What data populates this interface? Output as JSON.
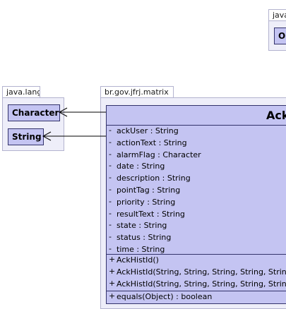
{
  "packages": {
    "java_lang": {
      "name": "java.lang",
      "classes": [
        "Character",
        "String"
      ]
    },
    "java_top": {
      "name": "java.",
      "class_partial": "Ob"
    },
    "matrix": {
      "name": "br.gov.jfrj.matrix"
    }
  },
  "main_class": {
    "name": "Ack",
    "attributes": [
      {
        "vis": "-",
        "text": "ackUser : String"
      },
      {
        "vis": "-",
        "text": "actionText : String"
      },
      {
        "vis": "-",
        "text": "alarmFlag : Character"
      },
      {
        "vis": "-",
        "text": "date : String"
      },
      {
        "vis": "-",
        "text": "description : String"
      },
      {
        "vis": "-",
        "text": "pointTag : String"
      },
      {
        "vis": "-",
        "text": "priority : String"
      },
      {
        "vis": "-",
        "text": "resultText : String"
      },
      {
        "vis": "-",
        "text": "state : String"
      },
      {
        "vis": "-",
        "text": "status : String"
      },
      {
        "vis": "-",
        "text": "time : String"
      }
    ],
    "constructors": [
      {
        "vis": "+",
        "text": "AckHistId()"
      },
      {
        "vis": "+",
        "text": "AckHistId(String, String, String, String, String"
      },
      {
        "vis": "+",
        "text": "AckHistId(String, String, String, String, String"
      }
    ],
    "methods": [
      {
        "vis": "+",
        "text": "equals(Object) : boolean"
      }
    ]
  },
  "colors": {
    "class_fill": "#c4c4f2",
    "class_border": "#33336b",
    "package_fill": "#eeeef9",
    "package_border": "#b3b3cf"
  }
}
